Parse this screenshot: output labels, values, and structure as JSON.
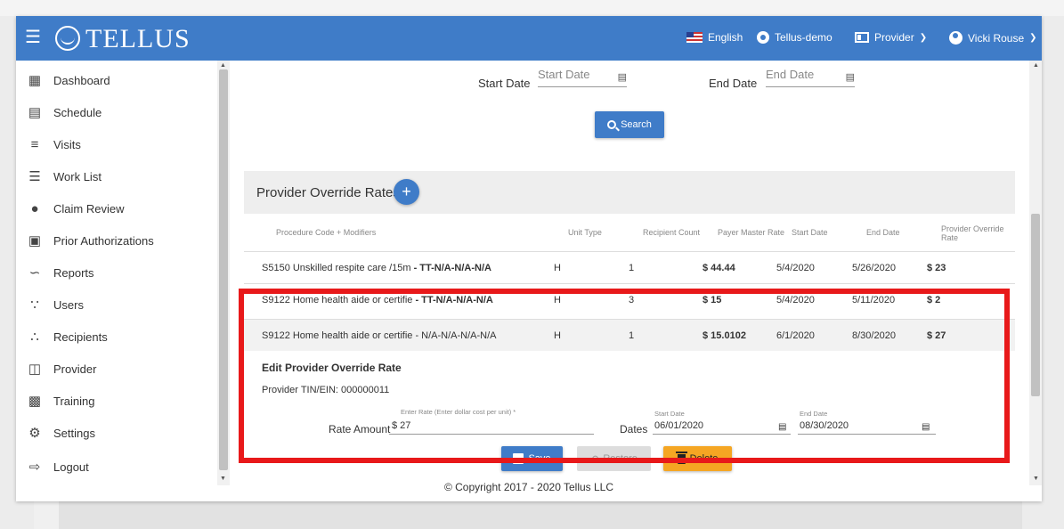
{
  "header": {
    "logo": "TELLUS",
    "language": "English",
    "org": "Tellus-demo",
    "role": "Provider",
    "user": "Vicki Rouse"
  },
  "sidebar": {
    "items": [
      {
        "label": "Dashboard",
        "icon": "dashboard-icon"
      },
      {
        "label": "Schedule",
        "icon": "calendar-icon"
      },
      {
        "label": "Visits",
        "icon": "filter-icon"
      },
      {
        "label": "Work List",
        "icon": "list-icon"
      },
      {
        "label": "Claim Review",
        "icon": "alert-icon"
      },
      {
        "label": "Prior Authorizations",
        "icon": "calendar-check-icon"
      },
      {
        "label": "Reports",
        "icon": "trend-icon"
      },
      {
        "label": "Users",
        "icon": "group-icon"
      },
      {
        "label": "Recipients",
        "icon": "people-icon"
      },
      {
        "label": "Provider",
        "icon": "clipboard-icon"
      },
      {
        "label": "Training",
        "icon": "training-icon"
      },
      {
        "label": "Settings",
        "icon": "gear-icon"
      },
      {
        "label": "Logout",
        "icon": "logout-icon"
      }
    ]
  },
  "filters": {
    "start_label": "Start Date",
    "start_placeholder": "Start Date",
    "end_label": "End Date",
    "end_placeholder": "End Date",
    "search_label": "Search"
  },
  "panel": {
    "title": "Provider Override Rates",
    "add_symbol": "+"
  },
  "table": {
    "headers": [
      "Procedure Code + Modifiers",
      "Unit Type",
      "Recipient Count",
      "Payer Master Rate",
      "Start Date",
      "End Date",
      "Provider Override",
      "Rate"
    ],
    "rows": [
      {
        "code": "S5150 Unskilled respite care /15m",
        "mods": " - TT-N/A-N/A-N/A",
        "unit": "H",
        "count": "1",
        "payer": "$ 44.44",
        "start": "5/4/2020",
        "end": "5/26/2020",
        "override": "$ 23"
      },
      {
        "code": "S9122 Home health aide or certifie",
        "mods": " - TT-N/A-N/A-N/A",
        "unit": "H",
        "count": "3",
        "payer": "$ 15",
        "start": "5/4/2020",
        "end": "5/11/2020",
        "override": "$ 2"
      },
      {
        "code": "S9122 Home health aide or certifie",
        "mods": " - N/A-N/A-N/A-N/A",
        "unit": "H",
        "count": "1",
        "payer": "$ 15.0102",
        "start": "6/1/2020",
        "end": "8/30/2020",
        "override": "$ 27"
      }
    ]
  },
  "edit": {
    "title": "Edit Provider Override Rate",
    "tin": "Provider TIN/EIN: 000000011",
    "rate_hint": "Enter Rate (Enter dollar cost per unit) *",
    "rate_label": "Rate Amount",
    "rate_value": "$ 27",
    "dates_label": "Dates",
    "start_hint": "Start Date",
    "start_value": "06/01/2020",
    "end_hint": "End Date",
    "end_value": "08/30/2020",
    "save_label": "Save",
    "restore_label": "Restore",
    "delete_label": "Delete"
  },
  "footer": {
    "copyright": "© Copyright 2017 - 2020 Tellus LLC"
  },
  "colors": {
    "primary": "#3f7cc8",
    "warning": "#f5a623",
    "highlight": "#e8191a"
  }
}
